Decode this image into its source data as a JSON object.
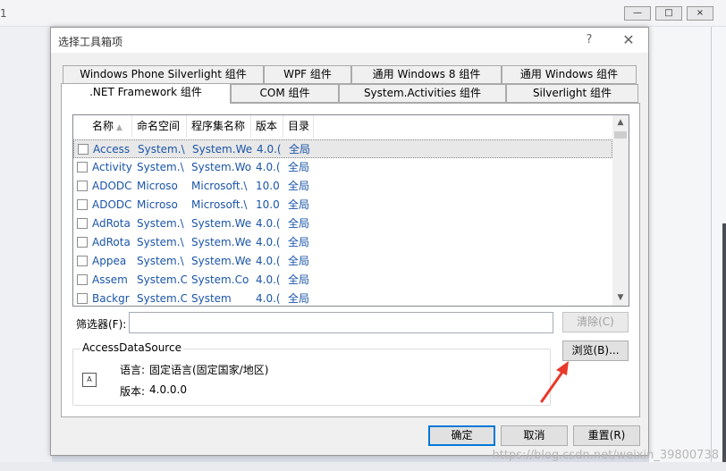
{
  "background": {
    "partial_title": "1",
    "window_buttons": [
      "—",
      "□",
      "×"
    ],
    "watermark": "https://blog.csdn.net/weixin_39800738"
  },
  "dialog": {
    "title": "选择工具箱项",
    "help": "?",
    "close": "✕"
  },
  "tabs": {
    "row1": [
      "Windows Phone Silverlight 组件",
      "WPF 组件",
      "通用 Windows 8 组件",
      "通用 Windows 组件"
    ],
    "row2": [
      ".NET Framework 组件",
      "COM 组件",
      "System.Activities 组件",
      "Silverlight 组件"
    ],
    "active": ".NET Framework 组件"
  },
  "list": {
    "columns": [
      "名称",
      "命名空间",
      "程序集名称",
      "版本",
      "目录"
    ],
    "sort_indicator": "▲",
    "rows": [
      {
        "name": "Access",
        "ns": "System.\\",
        "asm": "System.We",
        "ver": "4.0.(",
        "dir": "全局",
        "selected": true
      },
      {
        "name": "Activity",
        "ns": "System.\\",
        "asm": "System.Wo",
        "ver": "4.0.(",
        "dir": "全局",
        "selected": false
      },
      {
        "name": "ADODC",
        "ns": "Microso",
        "asm": "Microsoft.\\",
        "ver": "10.0",
        "dir": "全局",
        "selected": false
      },
      {
        "name": "ADODC",
        "ns": "Microso",
        "asm": "Microsoft.\\",
        "ver": "10.0",
        "dir": "全局",
        "selected": false
      },
      {
        "name": "AdRota",
        "ns": "System.\\",
        "asm": "System.We",
        "ver": "4.0.(",
        "dir": "全局",
        "selected": false
      },
      {
        "name": "AdRota",
        "ns": "System.\\",
        "asm": "System.We",
        "ver": "4.0.(",
        "dir": "全局",
        "selected": false
      },
      {
        "name": "Appea",
        "ns": "System.\\",
        "asm": "System.We",
        "ver": "4.0.(",
        "dir": "全局",
        "selected": false
      },
      {
        "name": "Assem",
        "ns": "System.C",
        "asm": "System.Co",
        "ver": "4.0.(",
        "dir": "全局",
        "selected": false
      },
      {
        "name": "Backgr",
        "ns": "System.C",
        "asm": "System",
        "ver": "4.0.(",
        "dir": "全局",
        "selected": false
      }
    ]
  },
  "filter": {
    "label": "筛选器(F):",
    "value": "",
    "clear_button": "清除(C)"
  },
  "details": {
    "group_title": "AccessDataSource",
    "language_label": "语言:",
    "language_value": "固定语言(固定国家/地区)",
    "version_label": "版本:",
    "version_value": "4.0.0.0",
    "browse_button": "浏览(B)..."
  },
  "footer": {
    "ok": "确定",
    "cancel": "取消",
    "reset": "重置(R)"
  },
  "colors": {
    "accent": "#0078d7",
    "link_text": "#1a55a8",
    "annotation_arrow": "#e8392a"
  }
}
